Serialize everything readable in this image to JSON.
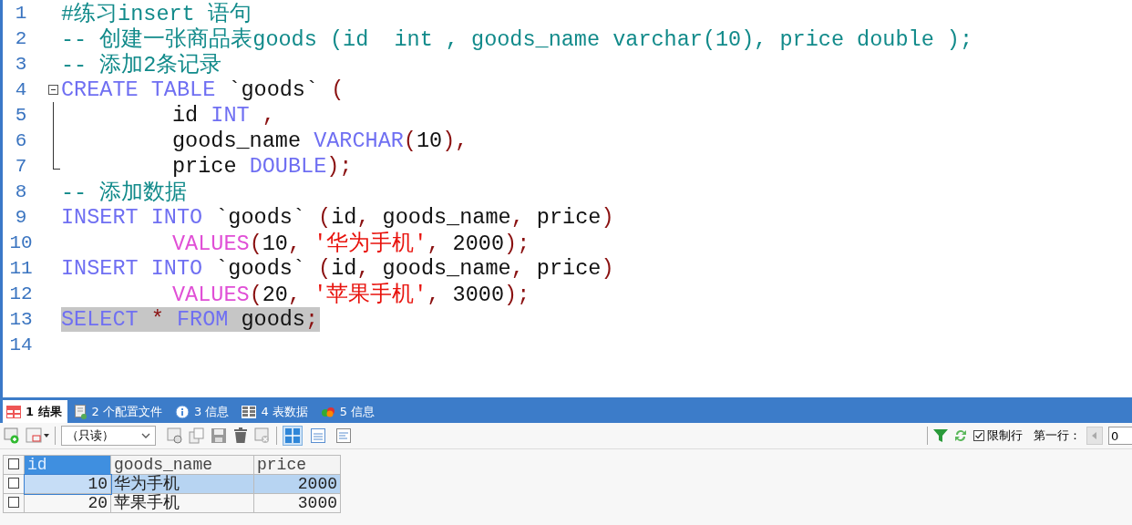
{
  "editor": {
    "lines": [
      {
        "number": "1",
        "tokens": [
          {
            "t": "#练习insert 语句",
            "kind": "comment"
          }
        ]
      },
      {
        "number": "2",
        "tokens": [
          {
            "t": "-- 创建一张商品表goods (id  int , goods_name varchar(10), price double );",
            "kind": "comment"
          }
        ]
      },
      {
        "number": "3",
        "tokens": [
          {
            "t": "-- 添加2条记录",
            "kind": "comment"
          }
        ]
      },
      {
        "number": "4",
        "expanded": true,
        "tokens": [
          {
            "t": "CREATE TABLE",
            "kind": "keyword"
          },
          {
            "t": " `goods` ",
            "kind": "plain"
          },
          {
            "t": "(",
            "kind": "punct"
          }
        ],
        "children": [
          {
            "number": "5",
            "indented": true,
            "tokens": [
              {
                "t": "id ",
                "kind": "plain"
              },
              {
                "t": "INT",
                "kind": "keyword"
              },
              {
                "t": " ,",
                "kind": "punct"
              }
            ]
          },
          {
            "number": "6",
            "indented": true,
            "tokens": [
              {
                "t": "goods_name ",
                "kind": "plain"
              },
              {
                "t": "VARCHAR",
                "kind": "keyword"
              },
              {
                "t": "(",
                "kind": "punct"
              },
              {
                "t": "10",
                "kind": "plain"
              },
              {
                "t": "),",
                "kind": "punct"
              }
            ]
          },
          {
            "number": "7",
            "indented": true,
            "tokens": [
              {
                "t": "price ",
                "kind": "plain"
              },
              {
                "t": "DOUBLE",
                "kind": "keyword"
              },
              {
                "t": ");",
                "kind": "punct"
              }
            ]
          }
        ]
      },
      {
        "number": "8",
        "tokens": [
          {
            "t": "-- 添加数据",
            "kind": "comment"
          }
        ]
      },
      {
        "number": "9",
        "tokens": [
          {
            "t": "INSERT INTO",
            "kind": "keyword"
          },
          {
            "t": " `goods` ",
            "kind": "plain"
          },
          {
            "t": "(",
            "kind": "punct"
          },
          {
            "t": "id",
            "kind": "plain"
          },
          {
            "t": ", ",
            "kind": "punct"
          },
          {
            "t": "goods_name",
            "kind": "plain"
          },
          {
            "t": ", ",
            "kind": "punct"
          },
          {
            "t": "price",
            "kind": "plain"
          },
          {
            "t": ")",
            "kind": "punct"
          }
        ]
      },
      {
        "number": "10",
        "indented": true,
        "tokens": [
          {
            "t": "VALUES",
            "kind": "function"
          },
          {
            "t": "(",
            "kind": "punct"
          },
          {
            "t": "10",
            "kind": "plain"
          },
          {
            "t": ", ",
            "kind": "punct"
          },
          {
            "t": "'华为手机'",
            "kind": "string"
          },
          {
            "t": ", ",
            "kind": "punct"
          },
          {
            "t": "2000",
            "kind": "plain"
          },
          {
            "t": ");",
            "kind": "punct"
          }
        ]
      },
      {
        "number": "11",
        "tokens": [
          {
            "t": "INSERT INTO",
            "kind": "keyword"
          },
          {
            "t": " `goods` ",
            "kind": "plain"
          },
          {
            "t": "(",
            "kind": "punct"
          },
          {
            "t": "id",
            "kind": "plain"
          },
          {
            "t": ", ",
            "kind": "punct"
          },
          {
            "t": "goods_name",
            "kind": "plain"
          },
          {
            "t": ", ",
            "kind": "punct"
          },
          {
            "t": "price",
            "kind": "plain"
          },
          {
            "t": ")",
            "kind": "punct"
          }
        ]
      },
      {
        "number": "12",
        "indented": true,
        "tokens": [
          {
            "t": "VALUES",
            "kind": "function"
          },
          {
            "t": "(",
            "kind": "punct"
          },
          {
            "t": "20",
            "kind": "plain"
          },
          {
            "t": ", ",
            "kind": "punct"
          },
          {
            "t": "'苹果手机'",
            "kind": "string"
          },
          {
            "t": ", ",
            "kind": "punct"
          },
          {
            "t": "3000",
            "kind": "plain"
          },
          {
            "t": ");",
            "kind": "punct"
          }
        ]
      },
      {
        "number": "13",
        "selected": true,
        "tokens": [
          {
            "t": "SELECT",
            "kind": "keyword"
          },
          {
            "t": " * ",
            "kind": "punct"
          },
          {
            "t": "FROM",
            "kind": "keyword"
          },
          {
            "t": " goods",
            "kind": "plain"
          },
          {
            "t": ";",
            "kind": "punct"
          }
        ]
      },
      {
        "number": "14"
      }
    ]
  },
  "result_tabs": [
    {
      "label": "1 结果",
      "selected": true
    },
    {
      "label": "2 个配置文件",
      "selected": false
    },
    {
      "label": "3 信息",
      "selected": false
    },
    {
      "label": "4 表数据",
      "selected": false
    },
    {
      "label": "5 信息",
      "selected": false
    }
  ],
  "toolbar": {
    "mode_select": "（只读）",
    "view_modes": [
      {
        "selected": true
      },
      {
        "selected": false
      },
      {
        "selected": false
      }
    ],
    "limit_rows": {
      "label": "限制行",
      "checked": true
    },
    "first_row_label": "第一行：",
    "first_row_value": "0"
  },
  "result_table": {
    "select_all": {
      "checked": false
    },
    "columns": [
      {
        "label": "id",
        "selected": true
      },
      {
        "label": "goods_name",
        "selected": false
      },
      {
        "label": "price",
        "selected": false
      }
    ],
    "rows": [
      {
        "checked": false,
        "selected": true,
        "cells": [
          "10",
          "华为手机",
          "2000"
        ]
      },
      {
        "checked": false,
        "selected": false,
        "cells": [
          "20",
          "苹果手机",
          "3000"
        ]
      }
    ]
  }
}
